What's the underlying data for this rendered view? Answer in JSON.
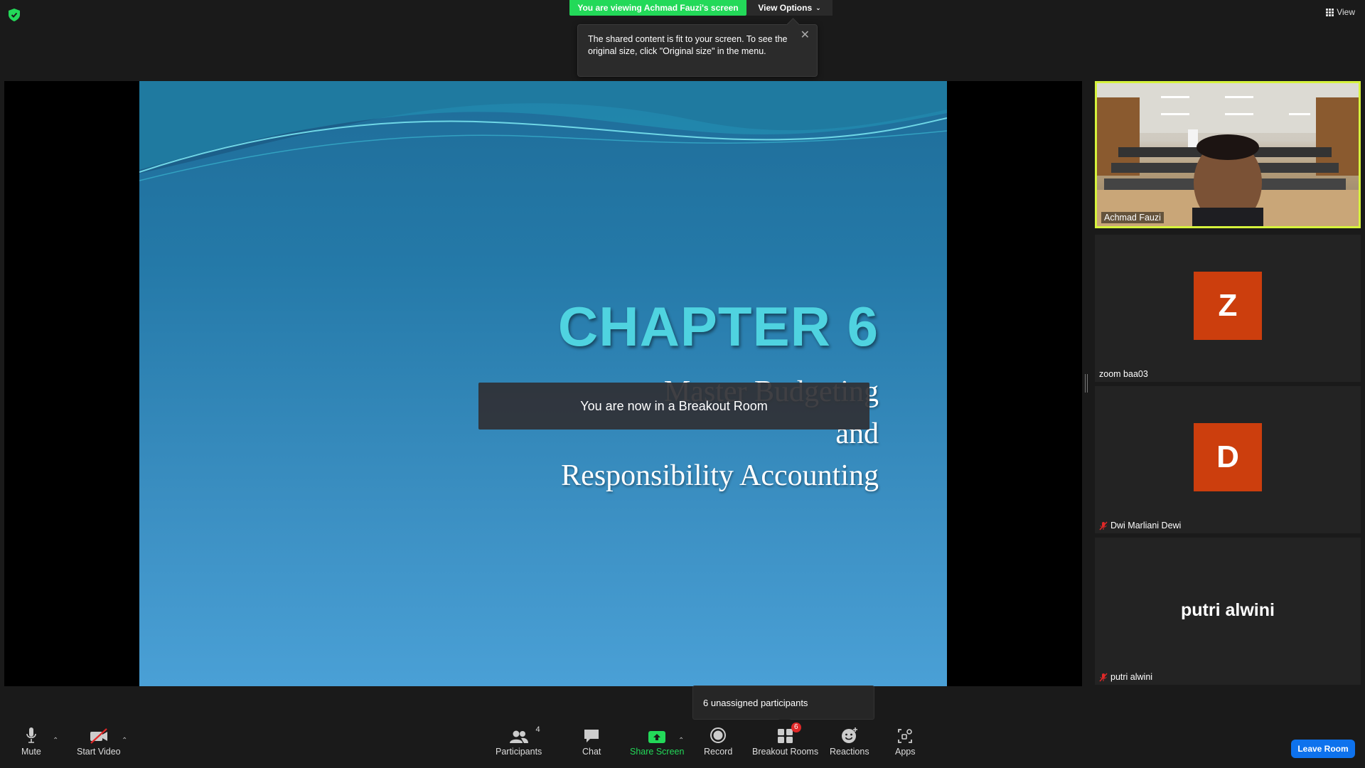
{
  "top": {
    "viewing_banner": "You are viewing Achmad Fauzi's screen",
    "view_options": "View Options",
    "view_label": "View",
    "tooltip": "The shared content is fit to your screen. To see the original size, click \"Original size\" in the menu."
  },
  "slide": {
    "chapter": "CHAPTER 6",
    "line1": "Master Budgeting",
    "line2": "and",
    "line3": "Responsibility Accounting"
  },
  "toast": "You are now in a Breakout Room",
  "participants": [
    {
      "name": "Achmad Fauzi",
      "type": "video",
      "muted": false,
      "active": true
    },
    {
      "name": "zoom baa03",
      "initial": "Z",
      "type": "avatar",
      "muted": false
    },
    {
      "name": "Dwi Marliani Dewi",
      "initial": "D",
      "type": "avatar",
      "muted": true
    },
    {
      "name": "putri alwini",
      "display": "putri alwini",
      "type": "text",
      "muted": true
    }
  ],
  "popup": "6 unassigned participants",
  "toolbar": {
    "mute": "Mute",
    "start_video": "Start Video",
    "participants": "Participants",
    "participants_count": "4",
    "chat": "Chat",
    "share_screen": "Share Screen",
    "record": "Record",
    "breakout_rooms": "Breakout Rooms",
    "breakout_badge": "6",
    "reactions": "Reactions",
    "apps": "Apps",
    "leave_room": "Leave Room"
  },
  "colors": {
    "banner_green": "#23d959",
    "active_border": "#d6f23c",
    "avatar_orange": "#cc3e0d",
    "leave_blue": "#0e72ed",
    "chapter_cyan": "#4fd3e0"
  }
}
